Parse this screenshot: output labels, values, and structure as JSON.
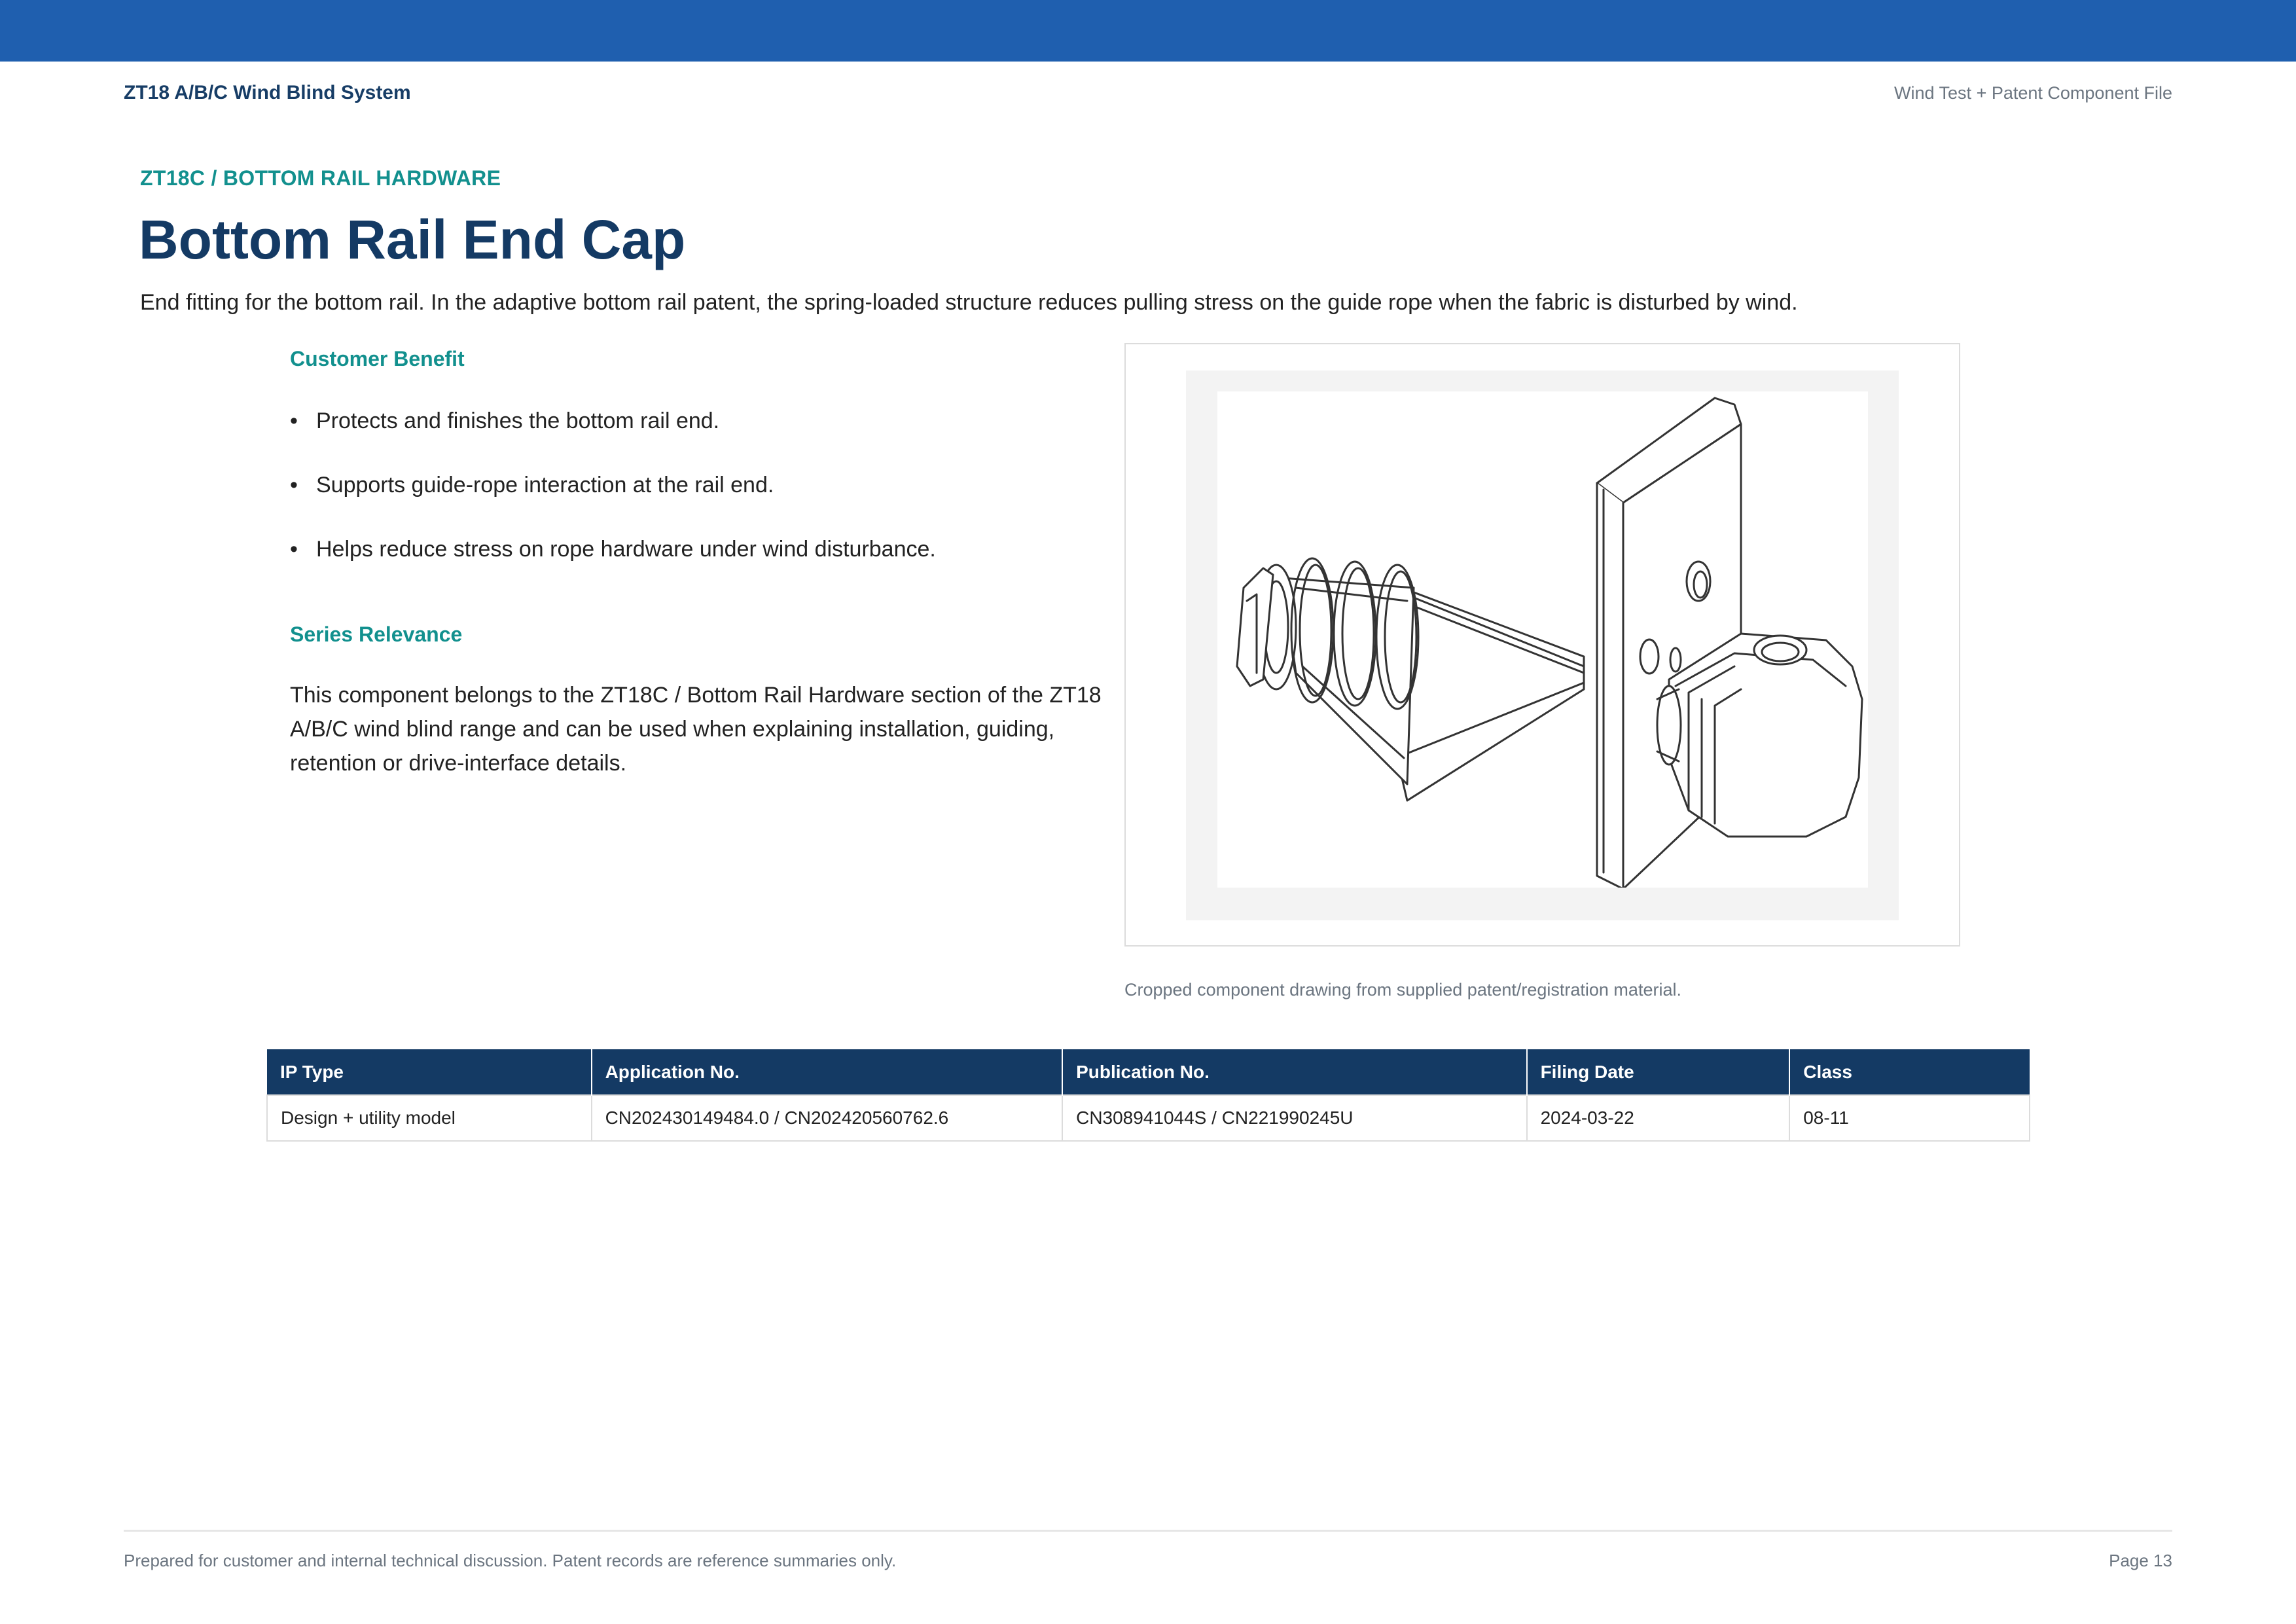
{
  "header": {
    "left": "ZT18 A/B/C Wind Blind System",
    "right": "Wind Test + Patent Component File"
  },
  "section": {
    "kicker": "ZT18C / BOTTOM RAIL HARDWARE",
    "title": "Bottom Rail End Cap",
    "intro": "End fitting for the bottom rail. In the adaptive bottom rail patent, the spring-loaded structure reduces pulling stress on the guide rope when the fabric is disturbed by wind."
  },
  "benefit": {
    "heading": "Customer Benefit",
    "bullets": [
      "Protects and finishes the bottom rail end.",
      "Supports guide-rope interaction at the rail end.",
      "Helps reduce stress on rope hardware under wind disturbance."
    ]
  },
  "series": {
    "heading": "Series Relevance",
    "text": "This component belongs to the ZT18C / Bottom Rail Hardware section of the ZT18 A/B/C wind blind range and can be used when explaining installation, guiding, retention or drive-interface details."
  },
  "figure": {
    "caption": "Cropped component drawing from supplied patent/registration material."
  },
  "table": {
    "headers": [
      "IP Type",
      "Application No.",
      "Publication No.",
      "Filing Date",
      "Class"
    ],
    "row": [
      "Design + utility model",
      "CN202430149484.0 / CN202420560762.6",
      "CN308941044S / CN221990245U",
      "2024-03-22",
      "08-11"
    ]
  },
  "footer": {
    "left": "Prepared for customer and internal technical discussion. Patent records are reference summaries only.",
    "right": "Page 13"
  },
  "colors": {
    "topbar": "#1f5faf",
    "accent_teal": "#12908e",
    "navy": "#143a64"
  }
}
